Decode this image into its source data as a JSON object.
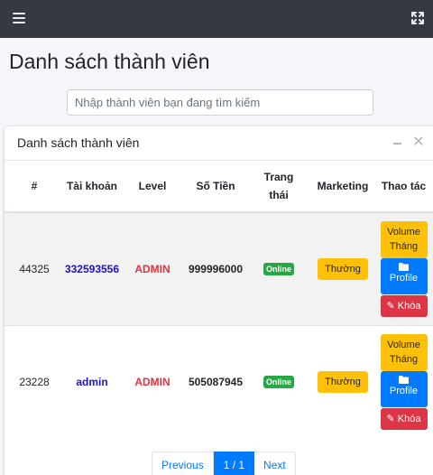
{
  "header": {
    "menu_icon": "menu-icon",
    "expand_icon": "expand-icon"
  },
  "page": {
    "title": "Danh sách thành viên"
  },
  "search": {
    "placeholder": "Nhập thành viên bạn đang tìm kiếm"
  },
  "card": {
    "title": "Danh sách thành viên",
    "tools": {
      "minimize_icon": "minus-icon",
      "close_icon": "close-icon"
    }
  },
  "table": {
    "columns": [
      "#",
      "Tài khoản",
      "Level",
      "Số Tiền",
      "Trang thái",
      "Marketing",
      "Thao tác"
    ],
    "rows": [
      {
        "id": "44325",
        "account": "332593556",
        "level": "ADMIN",
        "money": "999996000",
        "status": "Online",
        "marketing": "Thường",
        "volume": "Volume Tháng",
        "profile": "Profile",
        "lock": "Khóa"
      },
      {
        "id": "23228",
        "account": "admin",
        "level": "ADMIN",
        "money": "505087945",
        "status": "Online",
        "marketing": "Thường",
        "volume": "Volume Tháng",
        "profile": "Profile",
        "lock": "Khóa"
      }
    ]
  },
  "pagination": {
    "previous": "Previous",
    "current": "1 / 1",
    "next": "Next"
  },
  "colors": {
    "topbar": "#343a40",
    "primary": "#007bff",
    "danger": "#dc3545",
    "warning": "#ffc107",
    "success": "#28a745",
    "account_link": "#1d14c4"
  }
}
